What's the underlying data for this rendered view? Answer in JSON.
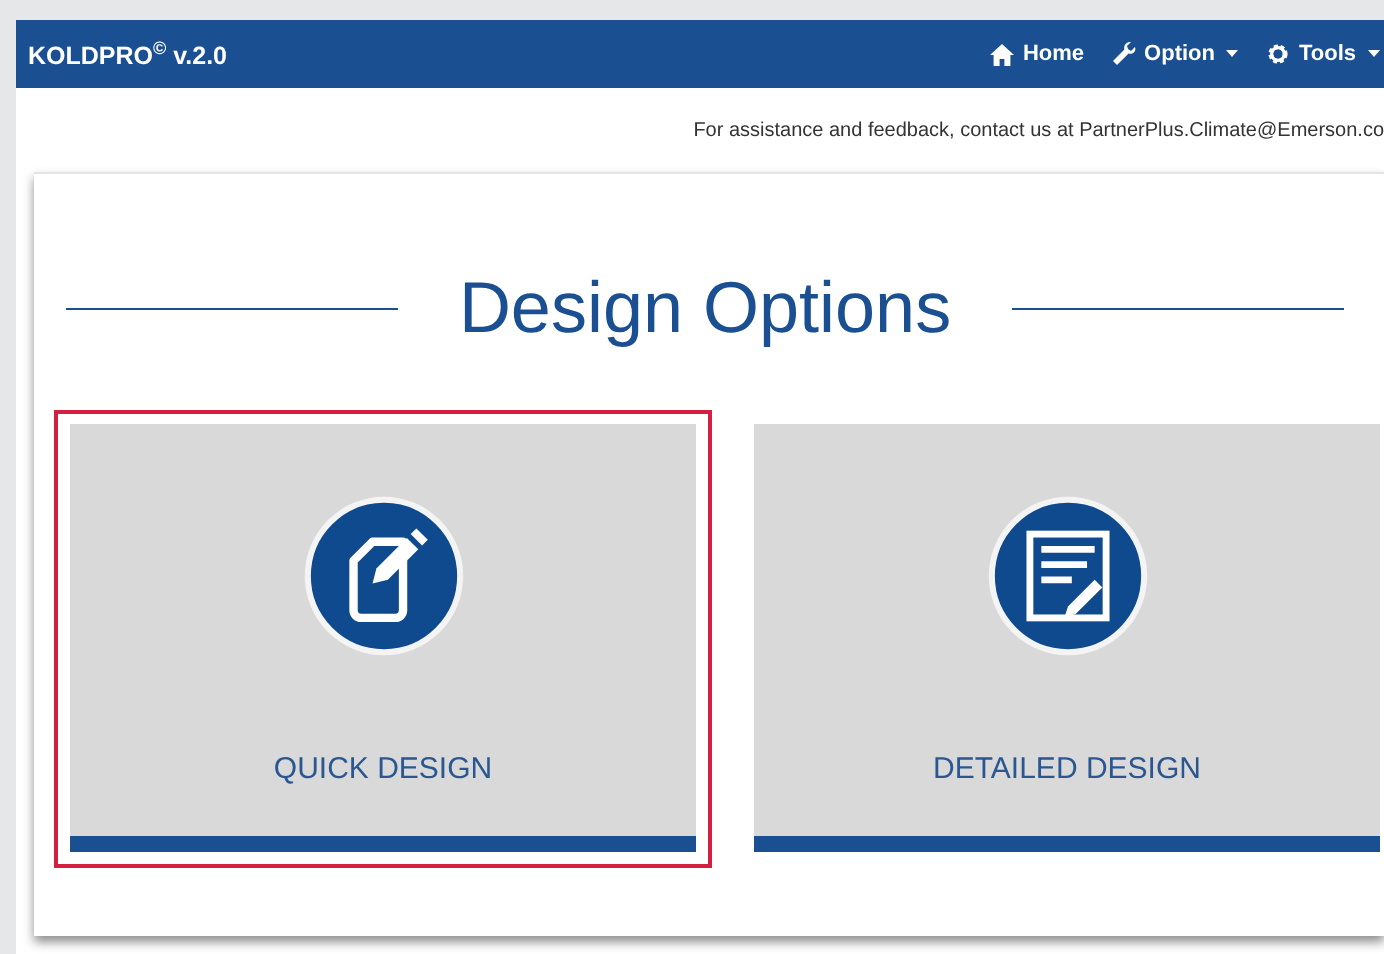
{
  "navbar": {
    "brand": "KOLDPRO$^{©}$ v.2.0",
    "items": [
      {
        "label": "Home",
        "kind": "home",
        "dropdown": false
      },
      {
        "label": "Option",
        "kind": "wrench",
        "dropdown": true
      },
      {
        "label": "Tools",
        "kind": "gear",
        "dropdown": true
      }
    ]
  },
  "notice": "For assistance and feedback, contact us at PartnerPlus.Climate@Emerson.co",
  "title": "Design Options",
  "options": [
    {
      "label": "QUICK DESIGN",
      "kind": "quick",
      "selected": true
    },
    {
      "label": "DETAILED DESIGN",
      "kind": "detailed",
      "selected": false
    }
  ]
}
